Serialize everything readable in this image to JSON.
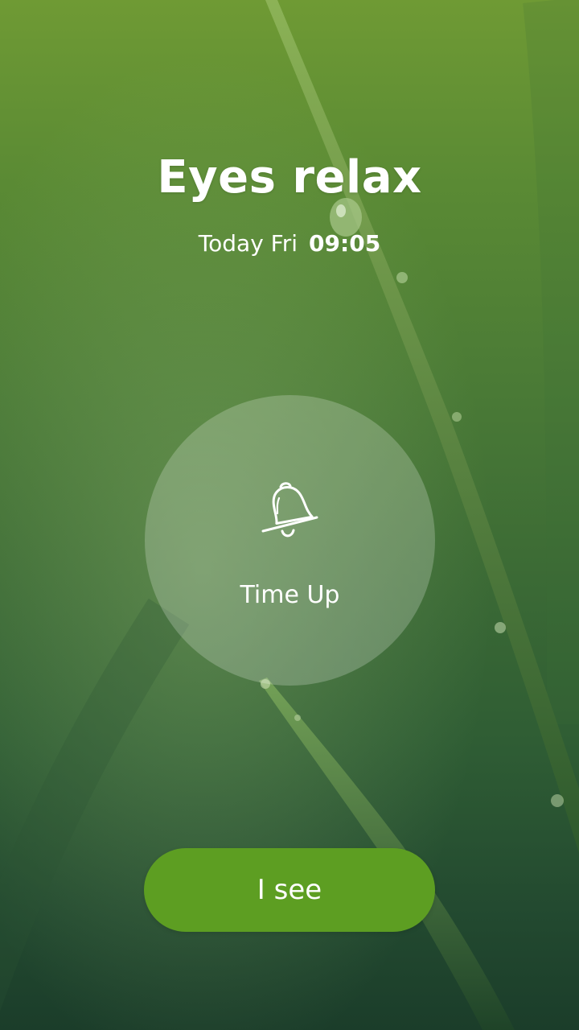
{
  "title": "Eyes relax",
  "date": {
    "day": "Today Fri",
    "time": "09:05"
  },
  "alert": {
    "icon": "bell-icon",
    "label": "Time Up"
  },
  "button": {
    "label": "I see"
  },
  "colors": {
    "accent": "#5d9e22",
    "background_top": "#6f9a34",
    "background_bottom": "#1b3d2a"
  }
}
